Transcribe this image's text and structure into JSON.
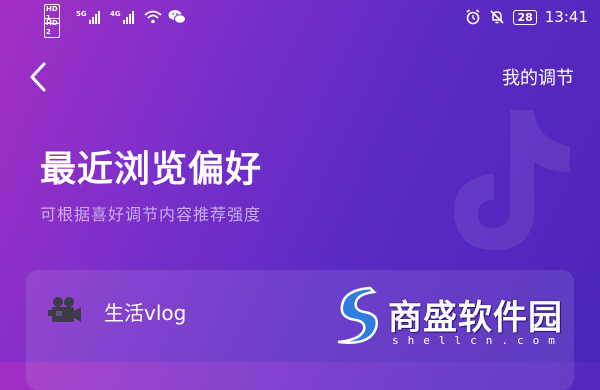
{
  "status_bar": {
    "sim1": "HD 1",
    "sim2": "HD 2",
    "net1": "5G",
    "net2": "4G",
    "battery": "28",
    "time": "13:41"
  },
  "nav": {
    "title": "我的调节"
  },
  "main": {
    "headline": "最近浏览偏好",
    "subline": "可根据喜好调节内容推荐强度"
  },
  "preferences": [
    {
      "label": "生活vlog",
      "icon": "camera-icon"
    }
  ],
  "watermark": {
    "name": "商盛软件园",
    "url": "shellcn.com"
  },
  "colors": {
    "gradient_start": "#a52fc4",
    "gradient_end": "#4b26b8",
    "brand_blue": "#2f7de1"
  }
}
